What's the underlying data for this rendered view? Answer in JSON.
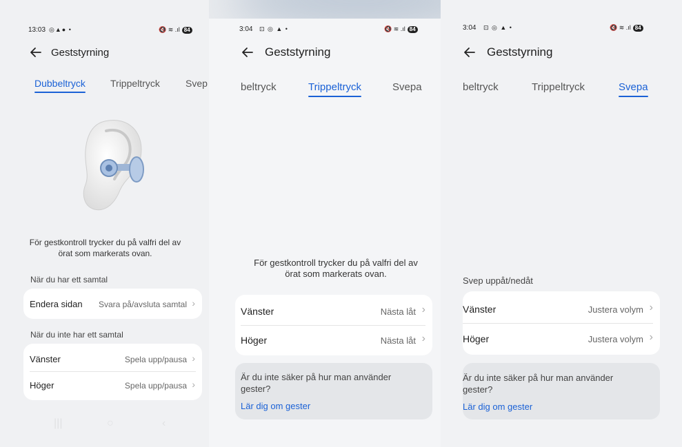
{
  "screens": [
    {
      "status": {
        "time": "13:03",
        "icons": "◎▲● •",
        "right_icons": "🔇 ≋ .ıl",
        "battery": "84"
      },
      "header": {
        "title": "Geststyrning"
      },
      "tabs": [
        "Dubbeltryck",
        "Trippeltryck",
        "Svep"
      ],
      "active_tab": 0,
      "description_line1": "För gestkontroll trycker du på valfri del av",
      "description_line2": "örat som markerats ovan.",
      "section1": "När du har ett samtal",
      "row_call_label": "Endera sidan",
      "row_call_value": "Svara på/avsluta samtal",
      "section2": "När du inte har ett samtal",
      "row_left_label": "Vänster",
      "row_left_value": "Spela upp/pausa",
      "row_right_label": "Höger",
      "row_right_value": "Spela upp/pausa"
    },
    {
      "status": {
        "time": "3:04",
        "icons": "⊡ ◎ ▲ •",
        "right_icons": "🔇 ≋ .ıl",
        "battery": "84"
      },
      "header": {
        "title": "Geststyrning"
      },
      "tabs": [
        "beltryck",
        "Trippeltryck",
        "Svepa"
      ],
      "active_tab": 1,
      "description_line1": "För gestkontroll trycker du på valfri del av",
      "description_line2": "örat som markerats ovan.",
      "row_left_label": "Vänster",
      "row_left_value": "Nästa låt",
      "row_right_label": "Höger",
      "row_right_value": "Nästa låt",
      "help_text_line1": "Är du inte säker på hur man använder",
      "help_text_line2": "gester?",
      "help_link": "Lär dig om gester"
    },
    {
      "status": {
        "time": "3:04",
        "icons": "⊡ ◎ ▲ •",
        "right_icons": "🔇 ≋ .ıl",
        "battery": "84"
      },
      "header": {
        "title": "Geststyrning"
      },
      "tabs": [
        "beltryck",
        "Trippeltryck",
        "Svepa"
      ],
      "active_tab": 2,
      "section1": "Svep uppåt/nedåt",
      "row_left_label": "Vänster",
      "row_left_value": "Justera volym",
      "row_right_label": "Höger",
      "row_right_value": "Justera volym",
      "help_text_line1": "Är du inte säker på hur man använder",
      "help_text_line2": "gester?",
      "help_link": "Lär dig om gester"
    }
  ],
  "icons": {
    "back": "back-arrow-icon",
    "chevron": "chevron-right-icon",
    "mute": "mute-icon",
    "wifi": "wifi-icon",
    "signal": "signal-icon",
    "battery": "battery-icon",
    "earbud": "earbud-illustration"
  },
  "colors": {
    "accent": "#1a61d6",
    "card": "#ffffff",
    "help_card": "#e4e6e9"
  }
}
